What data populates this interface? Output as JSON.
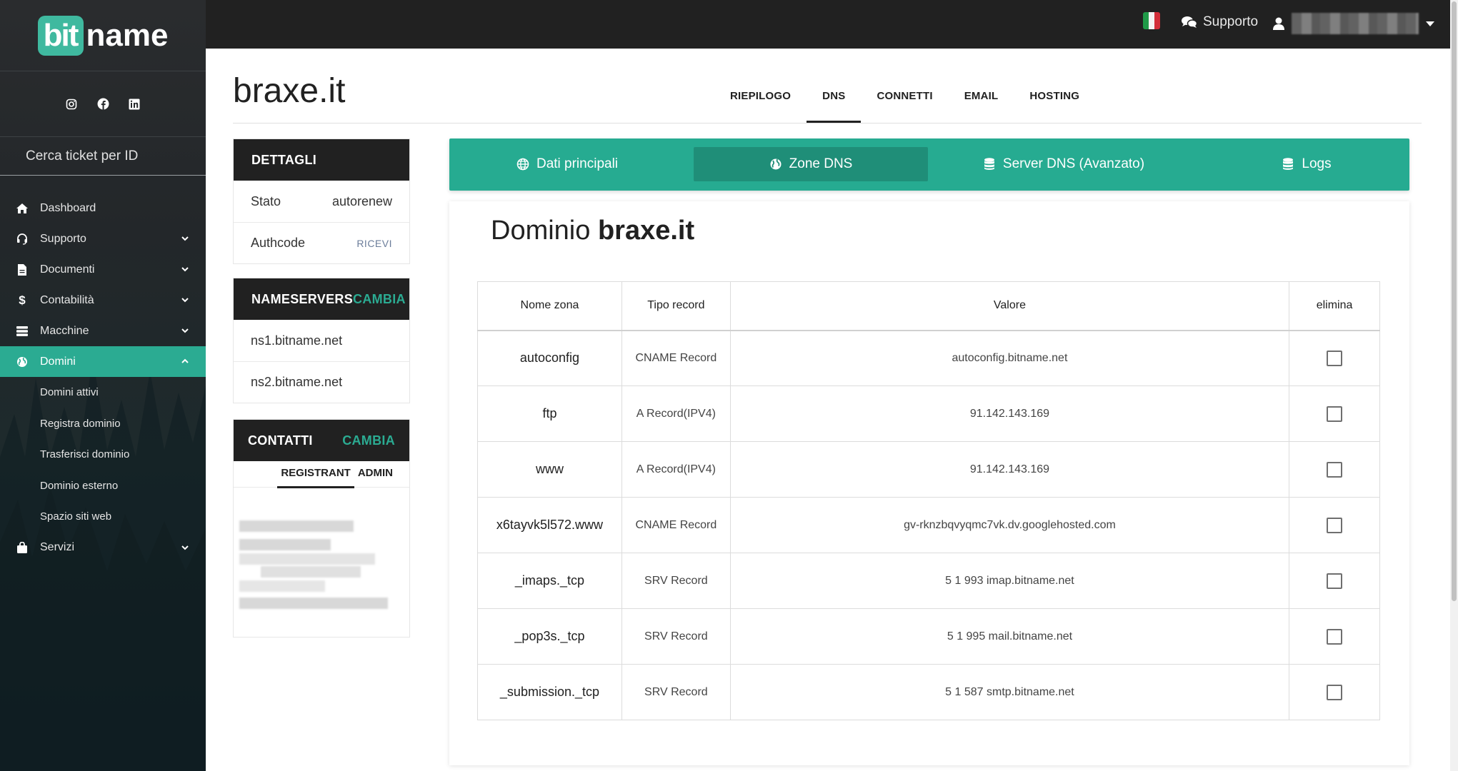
{
  "app": {
    "logo_mark": "bit",
    "logo_text": "name"
  },
  "topbar": {
    "support_label": "Supporto"
  },
  "sidebar": {
    "ticket_placeholder": "Cerca ticket per ID",
    "items": [
      {
        "label": "Dashboard",
        "icon": "home-icon"
      },
      {
        "label": "Supporto",
        "icon": "headset-icon"
      },
      {
        "label": "Documenti",
        "icon": "document-icon"
      },
      {
        "label": "Contabilità",
        "icon": "dollar-icon"
      },
      {
        "label": "Macchine",
        "icon": "server-icon"
      },
      {
        "label": "Domini",
        "icon": "globe-icon"
      },
      {
        "label": "Servizi",
        "icon": "bag-icon"
      }
    ],
    "subitems": [
      "Domini attivi",
      "Registra dominio",
      "Trasferisci dominio",
      "Dominio esterno",
      "Spazio siti web"
    ]
  },
  "header": {
    "domain": "braxe.it",
    "tabs": [
      "RIEPILOGO",
      "DNS",
      "CONNETTI",
      "EMAIL",
      "HOSTING"
    ],
    "active_tab": "DNS"
  },
  "details": {
    "title": "DETTAGLI",
    "stato_label": "Stato",
    "stato_value": "autorenew",
    "authcode_label": "Authcode",
    "authcode_action": "RICEVI"
  },
  "nameservers": {
    "title": "NAMESERVERS",
    "action": "CAMBIA",
    "ns1": "ns1.bitname.net",
    "ns2": "ns2.bitname.net"
  },
  "contacts": {
    "title": "CONTATTI",
    "action": "CAMBIA",
    "tab_registrant": "REGISTRANT",
    "tab_admin": "ADMIN"
  },
  "subnav": {
    "tabs": [
      "Dati principali",
      "Zone DNS",
      "Server DNS (Avanzato)",
      "Logs"
    ],
    "active": "Zone DNS"
  },
  "panel": {
    "title_prefix": "Dominio",
    "title_domain": "braxe.it"
  },
  "dns_table": {
    "headers": [
      "Nome zona",
      "Tipo record",
      "Valore",
      "elimina"
    ],
    "rows": [
      {
        "zone": "autoconfig",
        "type": "CNAME Record",
        "value": "autoconfig.bitname.net"
      },
      {
        "zone": "ftp",
        "type": "A Record(IPV4)",
        "value": "91.142.143.169"
      },
      {
        "zone": "www",
        "type": "A Record(IPV4)",
        "value": "91.142.143.169"
      },
      {
        "zone": "x6tayvk5l572.www",
        "type": "CNAME Record",
        "value": "gv-rknzbqvyqmc7vk.dv.googlehosted.com"
      },
      {
        "zone": "_imaps._tcp",
        "type": "SRV Record",
        "value": "5 1 993 imap.bitname.net"
      },
      {
        "zone": "_pop3s._tcp",
        "type": "SRV Record",
        "value": "5 1 995 mail.bitname.net"
      },
      {
        "zone": "_submission._tcp",
        "type": "SRV Record",
        "value": "5 1 587 smtp.bitname.net"
      }
    ]
  },
  "colors": {
    "accent": "#2bab92",
    "topbar": "#212121"
  }
}
